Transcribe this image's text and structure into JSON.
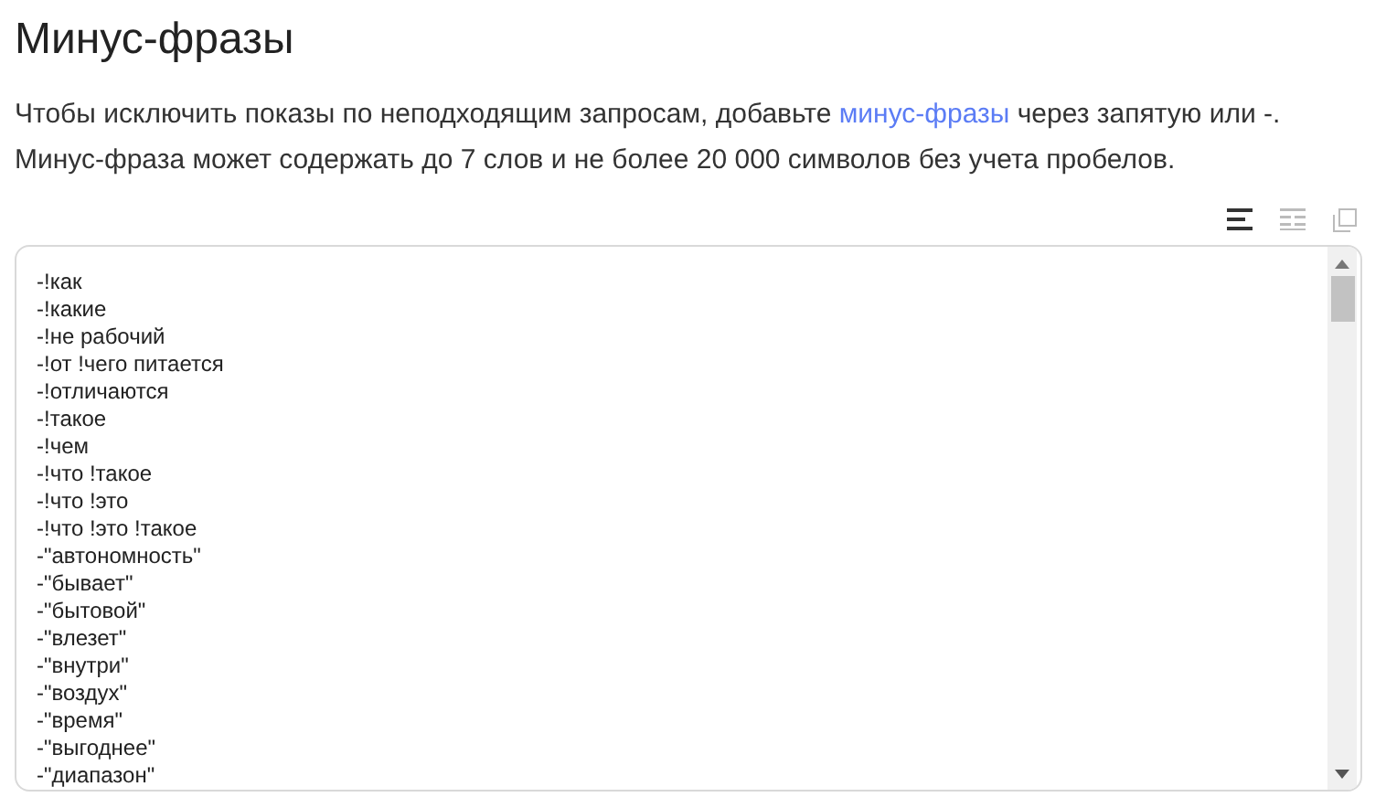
{
  "title": "Минус-фразы",
  "description": {
    "before": "Чтобы исключить показы по неподходящим запросам, добавьте ",
    "link": "минус-фразы",
    "after": " через запятую или -. Минус-фраза может содержать до 7 слов и не более 20 000 символов без учета пробелов."
  },
  "toolbar": [
    {
      "kind": "lines",
      "selected": true
    },
    {
      "kind": "columns",
      "selected": false
    },
    {
      "kind": "copy",
      "selected": false
    }
  ],
  "phrases": [
    "-!как",
    "-!какие",
    "-!не рабочий",
    "-!от !чего питается",
    "-!отличаются",
    "-!такое",
    "-!чем",
    "-!что !такое",
    "-!что !это",
    "-!что !это !такое",
    "-\"автономность\"",
    "-\"бывает\"",
    "-\"бытовой\"",
    "-\"влезет\"",
    "-\"внутри\"",
    "-\"воздух\"",
    "-\"время\"",
    "-\"выгоднее\"",
    "-\"диапазон\""
  ]
}
